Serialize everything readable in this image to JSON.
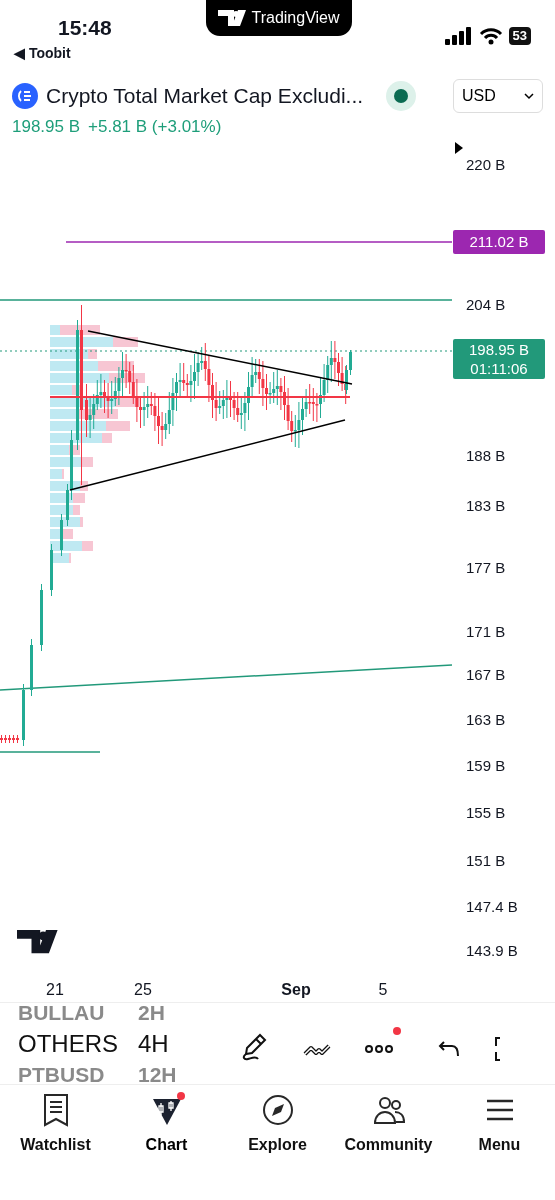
{
  "status_bar": {
    "time": "15:48",
    "back_arrow": "◀",
    "back_app": "Toobit",
    "battery": "53"
  },
  "top_pill": {
    "title": "TradingView"
  },
  "header": {
    "symbol": "Crypto Total Market Cap Excludi...",
    "market_open": true,
    "currency": "USD",
    "price": "198.95 B",
    "change": "+5.81 B (+3.01%)"
  },
  "chart": {
    "y_labels": [
      "220 B",
      "204 B",
      "188 B",
      "183 B",
      "177 B",
      "171 B",
      "167 B",
      "163 B",
      "159 B",
      "155 B",
      "151 B",
      "147.4 B",
      "143.9 B"
    ],
    "alert_label": "211.02 B",
    "price_label": "198.95 B",
    "countdown": "01:11:06",
    "x_labels": [
      {
        "text": "21",
        "bold": false
      },
      {
        "text": "25",
        "bold": false
      },
      {
        "text": "Sep",
        "bold": true
      },
      {
        "text": "5",
        "bold": false
      }
    ]
  },
  "symbol_picker": {
    "symbols": [
      {
        "label": "BULLAU",
        "selected": false
      },
      {
        "label": "OTHERS",
        "selected": true
      },
      {
        "label": "PTBUSD",
        "selected": false
      }
    ],
    "intervals": [
      {
        "label": "2H",
        "selected": false
      },
      {
        "label": "4H",
        "selected": true
      },
      {
        "label": "12H",
        "selected": false
      }
    ]
  },
  "toolbar": [
    {
      "kind": "draw",
      "badge": false
    },
    {
      "kind": "indicators",
      "badge": false
    },
    {
      "kind": "more",
      "badge": true
    },
    {
      "kind": "undo",
      "badge": false
    },
    {
      "kind": "fullscreen",
      "badge": false
    }
  ],
  "nav": [
    {
      "label": "Watchlist",
      "kind": "watchlist",
      "selected": false,
      "badge": false
    },
    {
      "label": "Chart",
      "kind": "chart",
      "selected": true,
      "badge": true
    },
    {
      "label": "Explore",
      "kind": "explore",
      "selected": false,
      "badge": false
    },
    {
      "label": "Community",
      "kind": "community",
      "selected": false,
      "badge": false
    },
    {
      "label": "Menu",
      "kind": "menu",
      "selected": false,
      "badge": false
    }
  ]
}
